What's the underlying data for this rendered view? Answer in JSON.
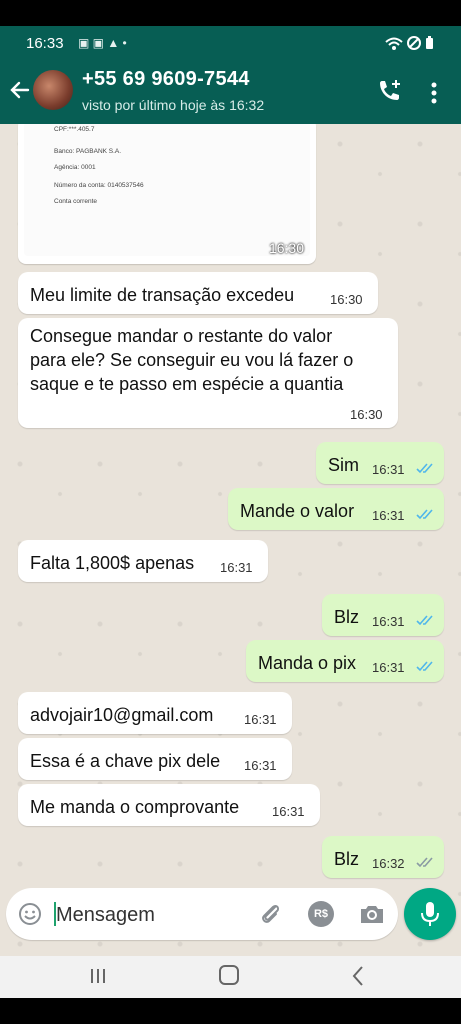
{
  "status_bar": {
    "time": "16:33"
  },
  "header": {
    "contact_name": "+55 69 9609-7544",
    "last_seen": "visto por último hoje às 16:32"
  },
  "document": {
    "lines": [
      "CPF:***.405.7",
      "Banco: PAGBANK S.A.",
      "Agência: 0001",
      "Número da conta: 0140537546",
      "Conta corrente"
    ],
    "time": "16:30"
  },
  "messages": [
    {
      "dir": "in",
      "text": "Meu limite de transação excedeu",
      "time": "16:30"
    },
    {
      "dir": "in",
      "text_lines": [
        "Consegue mandar o restante do valor",
        "para ele? Se conseguir eu vou lá fazer o",
        "saque e te passo em espécie a quantia"
      ],
      "time": "16:30"
    },
    {
      "dir": "out",
      "text": "Sim",
      "time": "16:31",
      "status": "read"
    },
    {
      "dir": "out",
      "text": "Mande o valor",
      "time": "16:31",
      "status": "read"
    },
    {
      "dir": "in",
      "text": "Falta 1,800$ apenas",
      "time": "16:31"
    },
    {
      "dir": "out",
      "text": "Blz",
      "time": "16:31",
      "status": "read"
    },
    {
      "dir": "out",
      "text": "Manda o pix",
      "time": "16:31",
      "status": "read"
    },
    {
      "dir": "in",
      "text": "advojair10@gmail.com",
      "time": "16:31"
    },
    {
      "dir": "in",
      "text": "Essa é a chave pix dele",
      "time": "16:31"
    },
    {
      "dir": "in",
      "text": "Me manda o comprovante",
      "time": "16:31"
    },
    {
      "dir": "out",
      "text": "Blz",
      "time": "16:32",
      "status": "delivered"
    }
  ],
  "input": {
    "placeholder": "Mensagem",
    "currency_label": "R$"
  },
  "colors": {
    "header": "#075e54",
    "outgoing_bubble": "#dcf8c6",
    "incoming_bubble": "#ffffff",
    "read_check": "#4fb6ec",
    "delivered_check": "#8a9aa3",
    "mic_button": "#00a884"
  }
}
